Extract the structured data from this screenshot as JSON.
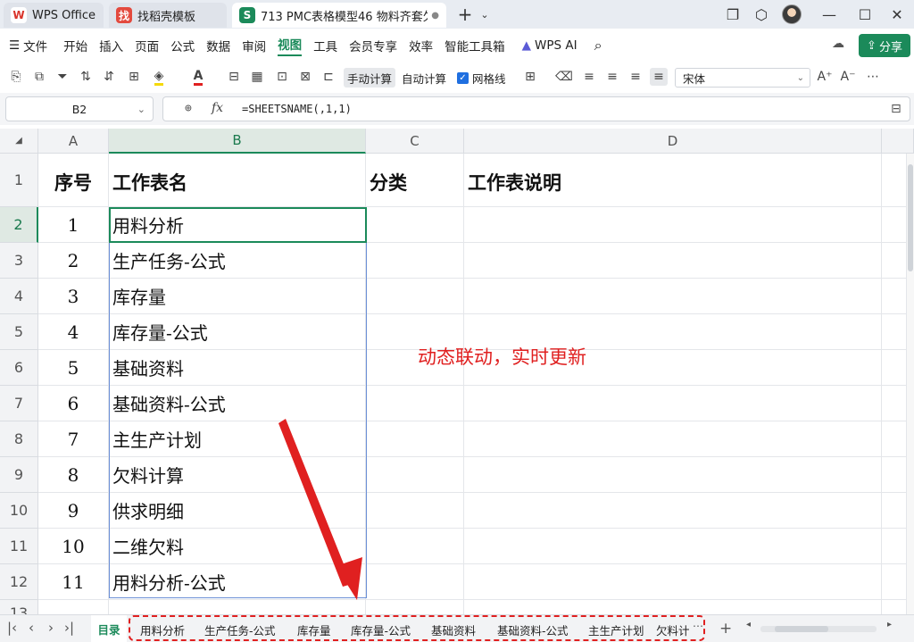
{
  "tabs": [
    {
      "label": "WPS Office",
      "logo": "W",
      "logo_color": "#d9342b"
    },
    {
      "label": "找稻壳模板",
      "logo": "找",
      "logo_color": "#e34a3e"
    },
    {
      "label": "713 PMC表格模型46 物料齐套欠",
      "logo": "S",
      "logo_color": "#1b8a5a"
    }
  ],
  "menu": {
    "hamburger": "☰",
    "file": "文件",
    "items": [
      "开始",
      "插入",
      "页面",
      "公式",
      "数据",
      "审阅",
      "视图",
      "工具",
      "会员专享",
      "效率",
      "智能工具箱"
    ],
    "active": "视图",
    "wps_ai": "WPS AI",
    "share": "分享"
  },
  "toolbar": {
    "manual_calc": "手动计算",
    "auto_calc": "自动计算",
    "gridlines": "网格线",
    "font": "宋体"
  },
  "formula": {
    "cell_ref": "B2",
    "fx": "fx",
    "expression": "=SHEETSNAME(,1,1)"
  },
  "columns": [
    "A",
    "B",
    "C",
    "D"
  ],
  "rows": [
    "1",
    "2",
    "3",
    "4",
    "5",
    "6",
    "7",
    "8",
    "9",
    "10",
    "11",
    "12",
    "13"
  ],
  "header_row": [
    "序号",
    "工作表名",
    "分类",
    "工作表说明"
  ],
  "data_rows": [
    {
      "no": "1",
      "name": "用料分析"
    },
    {
      "no": "2",
      "name": "生产任务-公式"
    },
    {
      "no": "3",
      "name": "库存量"
    },
    {
      "no": "4",
      "name": "库存量-公式"
    },
    {
      "no": "5",
      "name": "基础资料"
    },
    {
      "no": "6",
      "name": "基础资料-公式"
    },
    {
      "no": "7",
      "name": "主生产计划"
    },
    {
      "no": "8",
      "name": "欠料计算"
    },
    {
      "no": "9",
      "name": "供求明细"
    },
    {
      "no": "10",
      "name": "二维欠料"
    },
    {
      "no": "11",
      "name": "用料分析-公式"
    }
  ],
  "annotation": "动态联动，实时更新",
  "colors": {
    "accent": "#1b8a5a",
    "annotation": "#e02020"
  },
  "sheets": [
    "目录",
    "用料分析",
    "生产任务-公式",
    "库存量",
    "库存量-公式",
    "基础资料",
    "基础资料-公式",
    "主生产计划",
    "欠料计"
  ]
}
